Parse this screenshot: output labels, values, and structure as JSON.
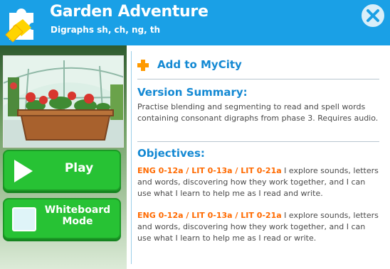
{
  "header": {
    "title": "Garden Adventure",
    "subtitle": "Digraphs sh, ch, ng, th"
  },
  "actions": {
    "play_label": "Play",
    "whiteboard_label_line1": "Whiteboard",
    "whiteboard_label_line2": "Mode"
  },
  "info": {
    "add_link": "Add to MyCity",
    "version_title": "Version Summary:",
    "version_text": "Practise blending and segmenting to read and spell words containing consonant digraphs from phase 3. Requires audio.",
    "objectives_title": "Objectives:",
    "objectives": [
      {
        "code": "ENG 0-12a / LIT 0-13a / LIT 0-21a",
        "text": "I explore sounds, letters and words, discovering how they work together, and I can use what I learn to help me as I read and write."
      },
      {
        "code": "ENG 0-12a / LIT 0-13a / LIT 0-21a",
        "text": "I explore sounds, letters and words, discovering how they work together, and I can use what I learn to help me as I read or write."
      }
    ]
  },
  "colors": {
    "header": "#1aa0e6",
    "button_green": "#27c234",
    "link_blue": "#1489d3",
    "code_orange": "#ff6a00",
    "plus_orange": "#ff9a00"
  },
  "icons": {
    "logo": "puzzle-piece-icon",
    "close": "close-icon",
    "play": "play-icon",
    "whiteboard": "whiteboard-icon",
    "add": "plus-icon"
  }
}
